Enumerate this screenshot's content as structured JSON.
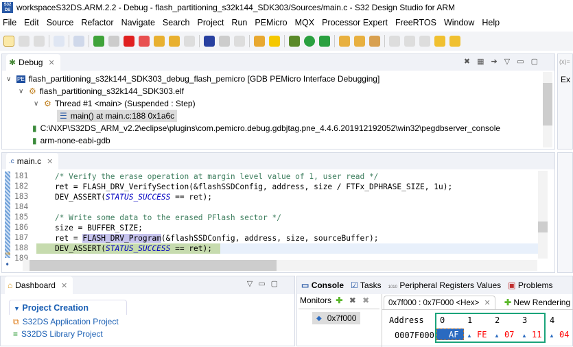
{
  "window": {
    "title": "workspaceS32DS.ARM.2.2 - Debug - flash_partitioning_s32k144_SDK303/Sources/main.c - S32 Design Studio for ARM",
    "logo": "S32 DS"
  },
  "menu": [
    "File",
    "Edit",
    "Source",
    "Refactor",
    "Navigate",
    "Search",
    "Project",
    "Run",
    "PEMicro",
    "MQX",
    "Processor Expert",
    "FreeRTOS",
    "Window",
    "Help"
  ],
  "debug": {
    "tab": "Debug",
    "tree": [
      "flash_partitioning_s32k144_SDK303_debug_flash_pemicro [GDB PEMicro Interface Debugging]",
      "flash_partitioning_s32k144_SDK303.elf",
      "Thread #1 <main> (Suspended : Step)",
      "main() at main.c:188 0x1a6c",
      "C:\\NXP\\S32DS_ARM_v2.2\\eclipse\\plugins\\com.pemicro.debug.gdbjtag.pne_4.4.6.201912192052\\win32\\pegdbserver_console",
      "arm-none-eabi-gdb"
    ],
    "side_label": "Ex",
    "side_tab": "(x)="
  },
  "editor": {
    "tab": "main.c",
    "lines": [
      {
        "n": "181",
        "t": "    /* Verify the erase operation at margin level value of 1, user read */"
      },
      {
        "n": "182",
        "t": "    ret = FLASH_DRV_VerifySection(&flashSSDConfig, address, size / FTFx_DPHRASE_SIZE, 1u);"
      },
      {
        "n": "183",
        "a": "    DEV_ASSERT(",
        "b": "STATUS_SUCCESS",
        "c": " == ret);"
      },
      {
        "n": "184",
        "t": ""
      },
      {
        "n": "185",
        "t": "    /* Write some data to the erased PFlash sector */"
      },
      {
        "n": "186",
        "t": "    size = BUFFER_SIZE;"
      },
      {
        "n": "187",
        "a": "    ret = ",
        "b": "FLASH_DRV_Program",
        "c": "(&flashSSDConfig, address, size, sourceBuffer);"
      },
      {
        "n": "188",
        "a": "    DEV_ASSERT(",
        "b": "STATUS_SUCCESS",
        "c": " == ret);"
      },
      {
        "n": "189",
        "t": ""
      }
    ]
  },
  "dashboard": {
    "tab": "Dashboard",
    "section": "Project Creation",
    "links": [
      "S32DS Application Project",
      "S32DS Library Project"
    ]
  },
  "console": {
    "tabs": [
      "Console",
      "Tasks",
      "Peripheral Registers Values",
      "Problems"
    ],
    "monitors_label": "Monitors",
    "monitor": "0x7f000",
    "rendering_tab": "0x7f000 : 0x7F000 <Hex>",
    "new_rendering": "New Rendering",
    "address_header": "Address",
    "columns": [
      "0",
      "1",
      "2",
      "3",
      "4"
    ],
    "row_address": "0007F000",
    "values": [
      "AF",
      "FE",
      "07",
      "11",
      "04"
    ]
  },
  "colors": {
    "accent": "#1a5fb4",
    "highlight_box": "#1aa37a",
    "changed": "#ff0000",
    "current_line": "#c6dbae"
  }
}
